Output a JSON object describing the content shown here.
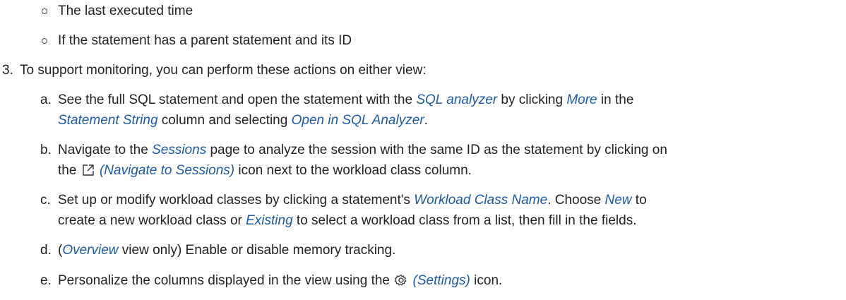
{
  "bullets": [
    "The last executed time",
    "If the statement has a parent statement and its ID"
  ],
  "step3": {
    "number": "3.",
    "text": "To support monitoring, you can perform these actions on either view:"
  },
  "items": {
    "a": {
      "letter": "a.",
      "t1": "See the full SQL statement and open the statement with the ",
      "e1": "SQL analyzer",
      "t2": " by clicking ",
      "e2": "More",
      "t3": " in the",
      "e3": "Statement String",
      "t4": " column and selecting ",
      "e4": "Open in SQL Analyzer",
      "t5": "."
    },
    "b": {
      "letter": "b.",
      "t1": "Navigate to the ",
      "e1": "Sessions",
      "t2": " page to analyze the session with the same ID as the statement by clicking on",
      "t3": "the ",
      "e2": " (Navigate to Sessions)",
      "t4": " icon next to the workload class column."
    },
    "c": {
      "letter": "c.",
      "t1": "Set up or modify workload classes by clicking a statement's ",
      "e1": "Workload Class Name",
      "t2": ". Choose ",
      "e2": "New",
      "t3": " to",
      "t4": "create a new workload class or ",
      "e3": "Existing",
      "t5": " to select a workload class from a list, then fill in the fields."
    },
    "d": {
      "letter": "d.",
      "t1": "(",
      "e1": "Overview",
      "t2": " view only) Enable or disable memory tracking."
    },
    "e": {
      "letter": "e.",
      "t1": "Personalize the columns displayed in the view using the ",
      "e1": " (Settings)",
      "t2": " icon."
    }
  },
  "icons": {
    "navigate": "navigate-external-icon",
    "settings": "gear-icon"
  },
  "colors": {
    "text": "#222222",
    "emphasis": "#1a5aa6"
  }
}
